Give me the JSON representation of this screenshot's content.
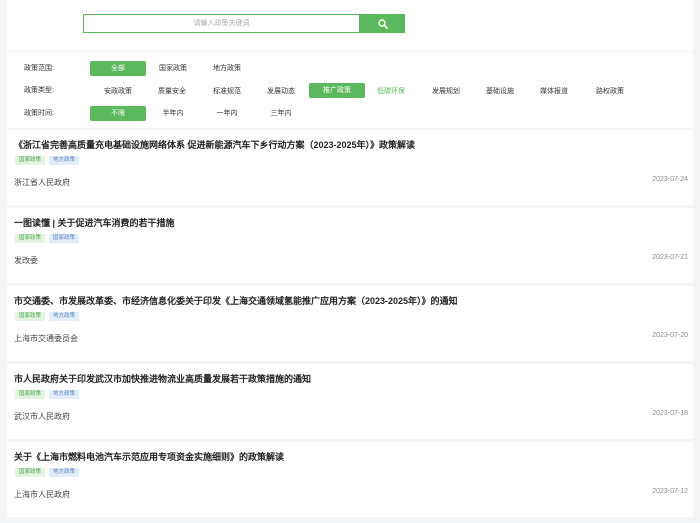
{
  "search": {
    "placeholder": "请输入政策关键词"
  },
  "filters": {
    "scope": {
      "label": "政策范围:",
      "options": [
        "全部",
        "国家政策",
        "地方政策"
      ]
    },
    "type": {
      "label": "政策类型:",
      "options": [
        "安政政策",
        "质量安全",
        "标准规范",
        "发展动态",
        "推广政策",
        "低碳环保",
        "发展规划",
        "基础设施",
        "媒体报道",
        "路权政策"
      ]
    },
    "time": {
      "label": "政策时间:",
      "options": [
        "不限",
        "半年内",
        "一年内",
        "三年内"
      ]
    }
  },
  "policies": [
    {
      "title": "《浙江省完善高质量充电基础设施网络体系 促进新能源汽车下乡行动方案（2023-2025年）》政策解读",
      "tags": [
        "国家政策",
        "地方政策"
      ],
      "issuer": "浙江省人民政府",
      "date": "2023-07-24"
    },
    {
      "title": "一图读懂 | 关于促进汽车消费的若干措施",
      "tags": [
        "国家政策",
        "国家政策"
      ],
      "issuer": "发改委",
      "date": "2023-07-21"
    },
    {
      "title": "市交通委、市发展改革委、市经济信息化委关于印发《上海交通领域氢能推广应用方案（2023-2025年）》的通知",
      "tags": [
        "国家政策",
        "地方政策"
      ],
      "issuer": "上海市交通委员会",
      "date": "2023-07-20"
    },
    {
      "title": "市人民政府关于印发武汉市加快推进物流业高质量发展若干政策措施的通知",
      "tags": [
        "国家政策",
        "地方政策"
      ],
      "issuer": "武汉市人民政府",
      "date": "2023-07-18"
    },
    {
      "title": "关于《上海市燃料电池汽车示范应用专项资金实施细则》的政策解读",
      "tags": [
        "国家政策",
        "地方政策"
      ],
      "issuer": "上海市人民政府",
      "date": "2023-07-12"
    }
  ],
  "colors": {
    "accent": "#5cb85c",
    "tag_green_bg": "#e2f3e2",
    "tag_blue_bg": "#e3edf9"
  },
  "icons": {
    "search": "search-icon"
  }
}
